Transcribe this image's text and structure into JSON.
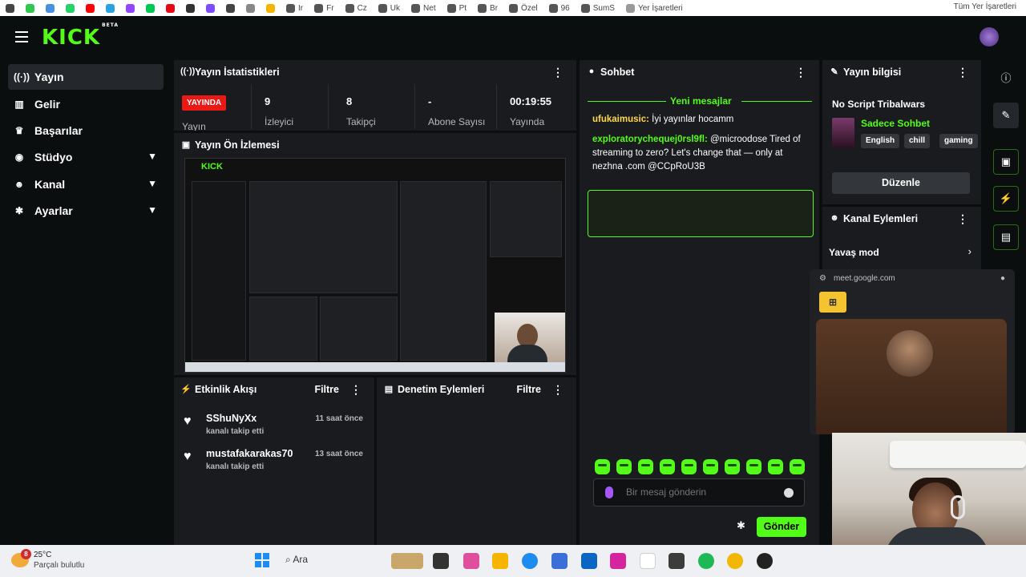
{
  "bookmarks": [
    {
      "label": "",
      "color": "#444444"
    },
    {
      "label": "",
      "color": "#2dc84d"
    },
    {
      "label": "",
      "color": "#4a90e2"
    },
    {
      "label": "",
      "color": "#25d366"
    },
    {
      "label": "",
      "color": "#ff0000"
    },
    {
      "label": "",
      "color": "#2aa3e0"
    },
    {
      "label": "",
      "color": "#9146ff"
    },
    {
      "label": "",
      "color": "#00c853"
    },
    {
      "label": "",
      "color": "#e50914"
    },
    {
      "label": "",
      "color": "#333333"
    },
    {
      "label": "",
      "color": "#7c4dff"
    },
    {
      "label": "",
      "color": "#444444"
    },
    {
      "label": "",
      "color": "#888888"
    },
    {
      "label": "",
      "color": "#f4b400"
    },
    {
      "label": "Ir",
      "color": "#555555"
    },
    {
      "label": "Fr",
      "color": "#555555"
    },
    {
      "label": "Cz",
      "color": "#555555"
    },
    {
      "label": "Uk",
      "color": "#555555"
    },
    {
      "label": "Net",
      "color": "#555555"
    },
    {
      "label": "Pt",
      "color": "#555555"
    },
    {
      "label": "Br",
      "color": "#555555"
    },
    {
      "label": "Özel",
      "color": "#555555"
    },
    {
      "label": "96",
      "color": "#555555"
    },
    {
      "label": "SumS",
      "color": "#555555"
    },
    {
      "label": "Yer İşaretleri",
      "color": "#999999"
    }
  ],
  "bookmarks_right": "Tüm Yer İşaretleri",
  "brand": {
    "logo": "KICK",
    "beta": "BETA",
    "accent": "#53fc18"
  },
  "sidebar": {
    "items": [
      {
        "label": "Yayın",
        "icon": "broadcast-icon",
        "glyph": "((·))"
      },
      {
        "label": "Gelir",
        "icon": "chart-icon",
        "glyph": "▥"
      },
      {
        "label": "Başarılar",
        "icon": "trophy-icon",
        "glyph": "♛"
      },
      {
        "label": "Stüdyo",
        "icon": "studio-icon",
        "glyph": "◉"
      },
      {
        "label": "Kanal",
        "icon": "users-icon",
        "glyph": "☻"
      },
      {
        "label": "Ayarlar",
        "icon": "gear-icon",
        "glyph": "✱"
      }
    ]
  },
  "stats": {
    "title": "Yayın İstatistikleri",
    "live_badge": "YAYINDA",
    "live_label": "Yayın",
    "items": [
      {
        "value": "9",
        "label": "İzleyici"
      },
      {
        "value": "8",
        "label": "Takipçi"
      },
      {
        "value": "-",
        "label": "Abone Sayısı"
      },
      {
        "value": "00:19:55",
        "label": "Yayında"
      }
    ]
  },
  "preview": {
    "title": "Yayın Ön İzlemesi"
  },
  "activity": {
    "title": "Etkinlik Akışı",
    "filter": "Filtre",
    "items": [
      {
        "name": "SShuNyXx",
        "sub": "kanalı takip etti",
        "time": "11 saat önce"
      },
      {
        "name": "mustafakarakas70",
        "sub": "kanalı takip etti",
        "time": "13 saat önce"
      }
    ]
  },
  "moderation": {
    "title": "Denetim Eylemleri",
    "filter": "Filtre"
  },
  "chat": {
    "title": "Sohbet",
    "new_messages": "Yeni mesajlar",
    "messages": [
      {
        "user": "ufukaimusic:",
        "text": " İyi yayınlar hocamm"
      },
      {
        "user": "exploratorychequej0rsl9fl:",
        "text": " @microodose Tired of streaming to zero? Let's change that — only at nezhna .com @CCpRoU3B"
      }
    ],
    "input_placeholder": "Bir mesaj gönderin",
    "send": "Gönder"
  },
  "stream_info": {
    "title": "Yayın bilgisi",
    "stream_title": "No Script Tribalwars",
    "category": "Sadece Sohbet",
    "tags": [
      "English",
      "chill",
      "gaming"
    ],
    "edit": "Düzenle"
  },
  "channel_actions": {
    "title": "Kanal Eylemleri",
    "items": [
      {
        "label": "Yavaş mod"
      }
    ]
  },
  "meet": {
    "url": "meet.google.com"
  },
  "taskbar": {
    "badge": "8",
    "temp": "25°C",
    "condition": "Parçalı bulutlu",
    "search": "Ara"
  }
}
